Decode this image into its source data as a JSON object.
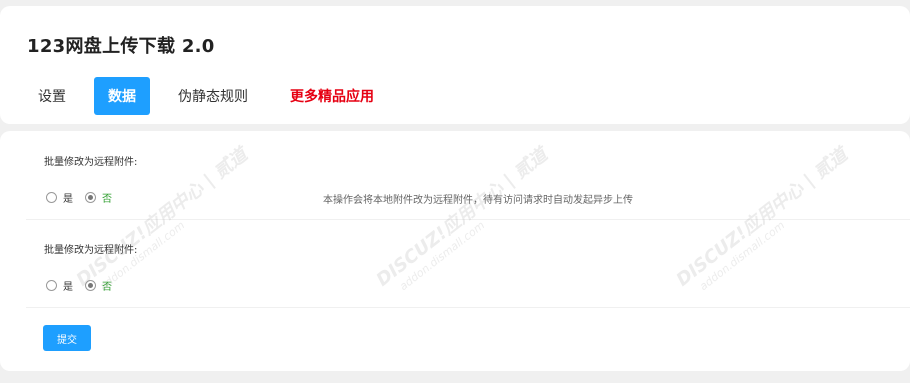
{
  "app": {
    "title": "123网盘上传下载 2.0"
  },
  "tabs": [
    {
      "label": "设置"
    },
    {
      "label": "数据"
    },
    {
      "label": "伪静态规则"
    },
    {
      "label": "更多精品应用"
    }
  ],
  "sections": [
    {
      "label": "批量修改为远程附件:",
      "options": [
        "是",
        "否"
      ],
      "selected": "否",
      "help": "本操作会将本地附件改为远程附件，待有访问请求时自动发起异步上传"
    },
    {
      "label": "批量修改为远程附件:",
      "options": [
        "是",
        "否"
      ],
      "selected": "否"
    }
  ],
  "submit_label": "提交",
  "watermark": {
    "brand": "DISCUZ!应用中心 | 贰道",
    "domain": "addon.dismall.com"
  },
  "colors": {
    "accent": "#1e9fff",
    "promo": "#e60012",
    "selected_text": "#2e9e2e"
  }
}
